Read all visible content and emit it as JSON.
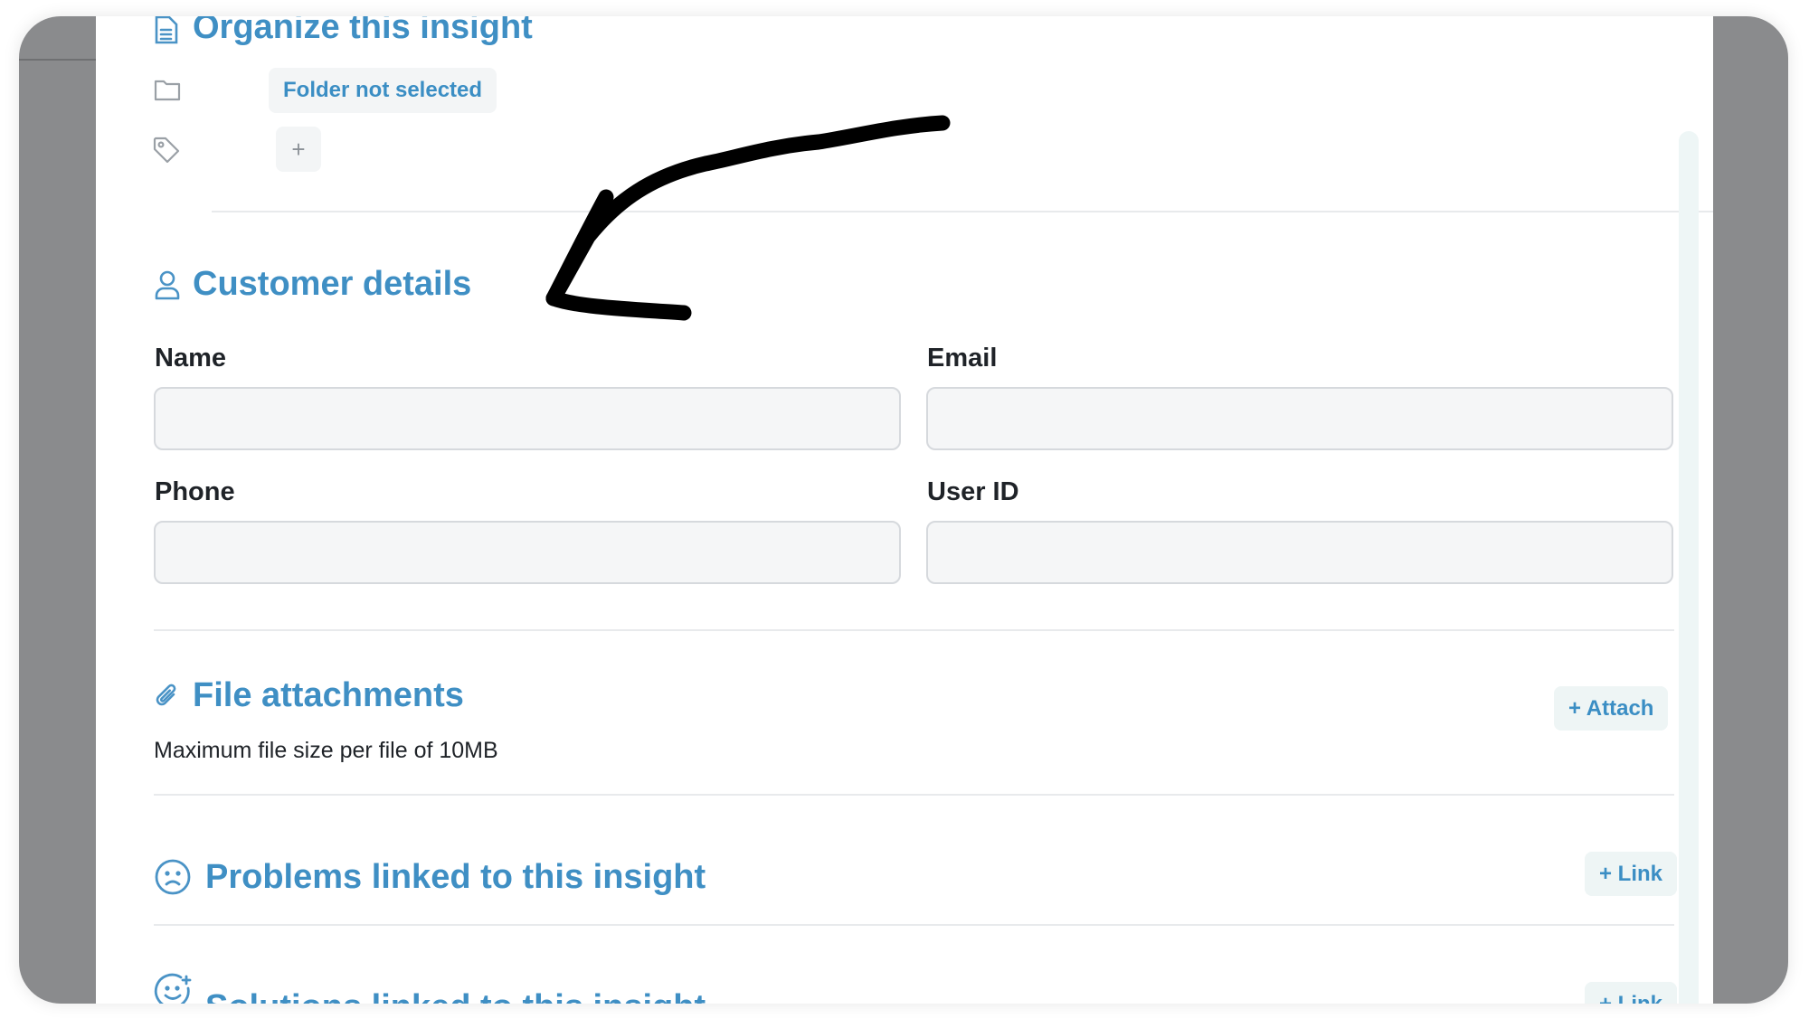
{
  "organize": {
    "title": "Organize this insight",
    "folder_label": "Folder not selected",
    "add_tag_label": "+"
  },
  "customer": {
    "title": "Customer details",
    "name_label": "Name",
    "email_label": "Email",
    "phone_label": "Phone",
    "userid_label": "User ID",
    "name_value": "",
    "email_value": "",
    "phone_value": "",
    "userid_value": ""
  },
  "attachments": {
    "title": "File attachments",
    "subtitle": "Maximum file size per file of 10MB",
    "attach_label": "+ Attach"
  },
  "problems": {
    "title": "Problems linked to this insight",
    "link_label": "+ Link"
  },
  "solutions": {
    "title": "Solutions linked to this insight",
    "link_label": "+ Link"
  },
  "colors": {
    "accent": "#3f8fc4",
    "backdrop": "#8a8b8d",
    "input_bg": "#f5f6f7"
  },
  "icons": {
    "organize": "document-icon",
    "folder": "folder-icon",
    "tag": "tag-icon",
    "customer": "user-icon",
    "attachments": "paperclip-icon",
    "problems": "sad-face-icon",
    "solutions": "happy-face-icon",
    "annotation": "hand-drawn-arrow"
  }
}
